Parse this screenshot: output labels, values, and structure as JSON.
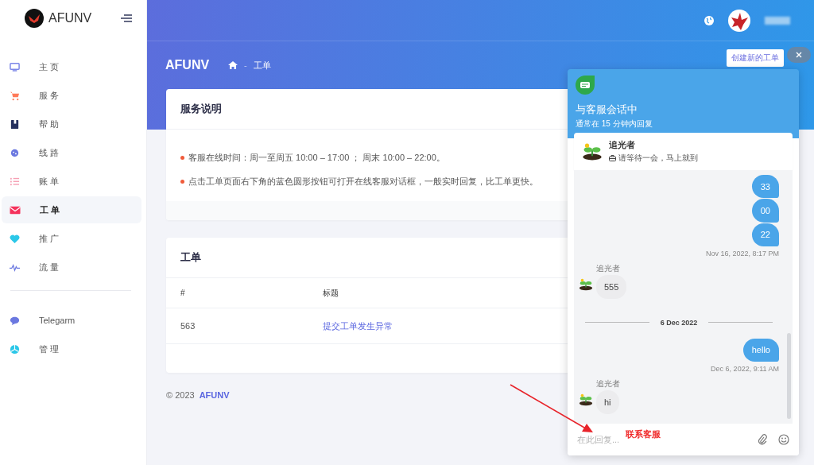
{
  "brand": {
    "name": "AFUNV"
  },
  "sidebar": {
    "items": [
      {
        "label": "主 页",
        "selected": false
      },
      {
        "label": "服 务",
        "selected": false
      },
      {
        "label": "帮 助",
        "selected": false
      },
      {
        "label": "线 路",
        "selected": false
      },
      {
        "label": "账 单",
        "selected": false
      },
      {
        "label": "工 单",
        "selected": true
      },
      {
        "label": "推 广",
        "selected": false
      },
      {
        "label": "流 量",
        "selected": false
      }
    ],
    "bottom_items": [
      {
        "label": "Telegarm",
        "selected": false
      },
      {
        "label": "管 理",
        "selected": false
      }
    ]
  },
  "page": {
    "title": "AFUNV",
    "breadcrumb_separator": "-",
    "breadcrumb": "工单",
    "create_button": "创建新的工单"
  },
  "notice_card": {
    "title": "服务说明",
    "lines": [
      "客服在线时间：周一至周五 10:00 – 17:00 ； 周末 10:00 – 22:00。",
      "点击工单页面右下角的蓝色圆形按钮可打开在线客服对话框，一般实时回复，比工单更快。"
    ]
  },
  "tickets_card": {
    "title": "工单",
    "columns": [
      "#",
      "标题"
    ],
    "rows": [
      {
        "id": "563",
        "title": "提交工单发生异常"
      }
    ]
  },
  "footer": {
    "copyright": "© 2023",
    "brand": "AFUNV"
  },
  "chat": {
    "title": "与客服会话中",
    "subtitle": "通常在 15 分钟内回复",
    "agent": {
      "name": "追光者",
      "status": "请等待一会，马上就到"
    },
    "messages": [
      {
        "kind": "outgoing",
        "text": "33"
      },
      {
        "kind": "outgoing",
        "text": "00"
      },
      {
        "kind": "outgoing",
        "text": "22"
      },
      {
        "kind": "time",
        "text": "Nov 16, 2022, 8:17 PM"
      },
      {
        "kind": "incoming",
        "sender": "追光者",
        "text": "555"
      },
      {
        "kind": "date",
        "text": "6 Dec 2022"
      },
      {
        "kind": "outgoing",
        "text": "hello"
      },
      {
        "kind": "time",
        "text": "Dec 6, 2022, 9:11 AM"
      },
      {
        "kind": "incoming",
        "sender": "追光者",
        "text": "hi"
      }
    ],
    "input": {
      "placeholder": "在此回复..."
    }
  },
  "annotation": {
    "text": "联系客服"
  }
}
